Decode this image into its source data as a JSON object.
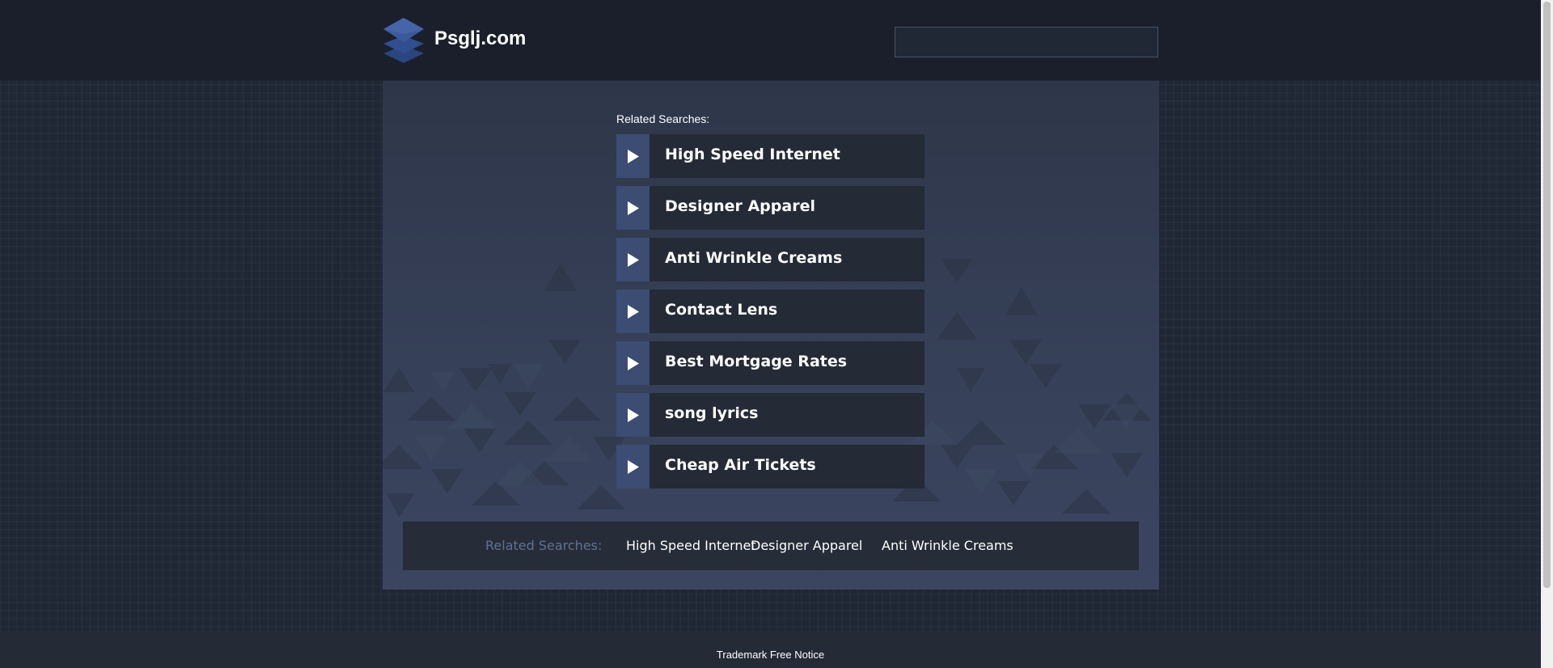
{
  "header": {
    "brand": "Psglj.com",
    "logo_icon": "stacked-layers-icon",
    "search_value": ""
  },
  "main": {
    "related_heading": "Related Searches:",
    "items": [
      {
        "label": "High Speed Internet",
        "icon": "play-arrow-icon"
      },
      {
        "label": "Designer Apparel",
        "icon": "play-arrow-icon"
      },
      {
        "label": "Anti Wrinkle Creams",
        "icon": "play-arrow-icon"
      },
      {
        "label": "Contact Lens",
        "icon": "play-arrow-icon"
      },
      {
        "label": "Best Mortgage Rates",
        "icon": "play-arrow-icon"
      },
      {
        "label": "song lyrics",
        "icon": "play-arrow-icon"
      },
      {
        "label": "Cheap Air Tickets",
        "icon": "play-arrow-icon"
      }
    ]
  },
  "bottom_bar": {
    "heading": "Related Searches:",
    "links": [
      "High Speed Internet",
      "Designer Apparel",
      "Anti Wrinkle Creams"
    ]
  },
  "footer": {
    "notice": "Trademark Free Notice"
  },
  "colors": {
    "page_bg": "#1f2634",
    "topbar_bg": "#1a1f2b",
    "panel_bg": "#364058",
    "item_bg": "#242a36",
    "arrow_box": "#3c4c73",
    "bottom_heading": "#5f7294",
    "logo_blue": "#3b5a9c"
  }
}
